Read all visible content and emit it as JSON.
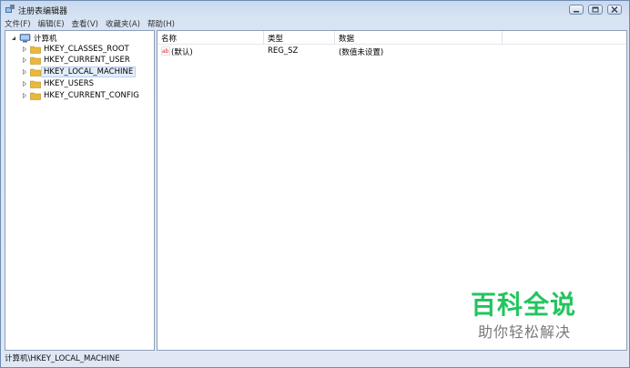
{
  "window": {
    "title": "注册表编辑器",
    "controls": {
      "minimize": "minimize",
      "maximize": "maximize",
      "close": "close"
    }
  },
  "menu": [
    "文件(F)",
    "编辑(E)",
    "查看(V)",
    "收藏夹(A)",
    "帮助(H)"
  ],
  "tree": {
    "root": "计算机",
    "items": [
      "HKEY_CLASSES_ROOT",
      "HKEY_CURRENT_USER",
      "HKEY_LOCAL_MACHINE",
      "HKEY_USERS",
      "HKEY_CURRENT_CONFIG"
    ],
    "selected": "HKEY_LOCAL_MACHINE"
  },
  "list": {
    "columns": [
      "名称",
      "类型",
      "数据"
    ],
    "rows": [
      {
        "name": "(默认)",
        "type": "REG_SZ",
        "data": "(数值未设置)"
      }
    ]
  },
  "status": {
    "path": "计算机\\HKEY_LOCAL_MACHINE"
  },
  "watermark": {
    "title": "百科全说",
    "subtitle": "助你轻松解决"
  },
  "colors": {
    "accent": "#22c55e",
    "folder": "#e8b93a",
    "selection": "#e3eefb"
  },
  "icons": {
    "app": "regedit-icon",
    "computer": "computer-icon",
    "folder": "folder-icon",
    "value": "string-value-icon"
  }
}
